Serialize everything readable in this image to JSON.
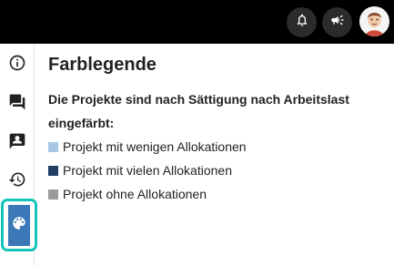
{
  "header": {
    "icons": [
      "bell-icon",
      "megaphone-icon"
    ],
    "avatar": "user-avatar"
  },
  "sidebar": {
    "items": [
      {
        "icon": "info-icon"
      },
      {
        "icon": "chat-icon"
      },
      {
        "icon": "contact-card-icon"
      },
      {
        "icon": "history-icon"
      },
      {
        "icon": "palette-icon",
        "active": true
      }
    ],
    "active_color": "#3a78b8",
    "highlight_color": "#14c4ba"
  },
  "panel": {
    "title": "Farblegende",
    "description": "Die Projekte sind nach Sättigung nach Arbeitslast eingefärbt:",
    "legend": [
      {
        "label": "Projekt mit wenigen Allokationen",
        "color": "#a7c7e7"
      },
      {
        "label": "Projekt mit vielen Allokationen",
        "color": "#1f3f63"
      },
      {
        "label": "Projekt ohne Allokationen",
        "color": "#9a9a9a"
      }
    ]
  }
}
